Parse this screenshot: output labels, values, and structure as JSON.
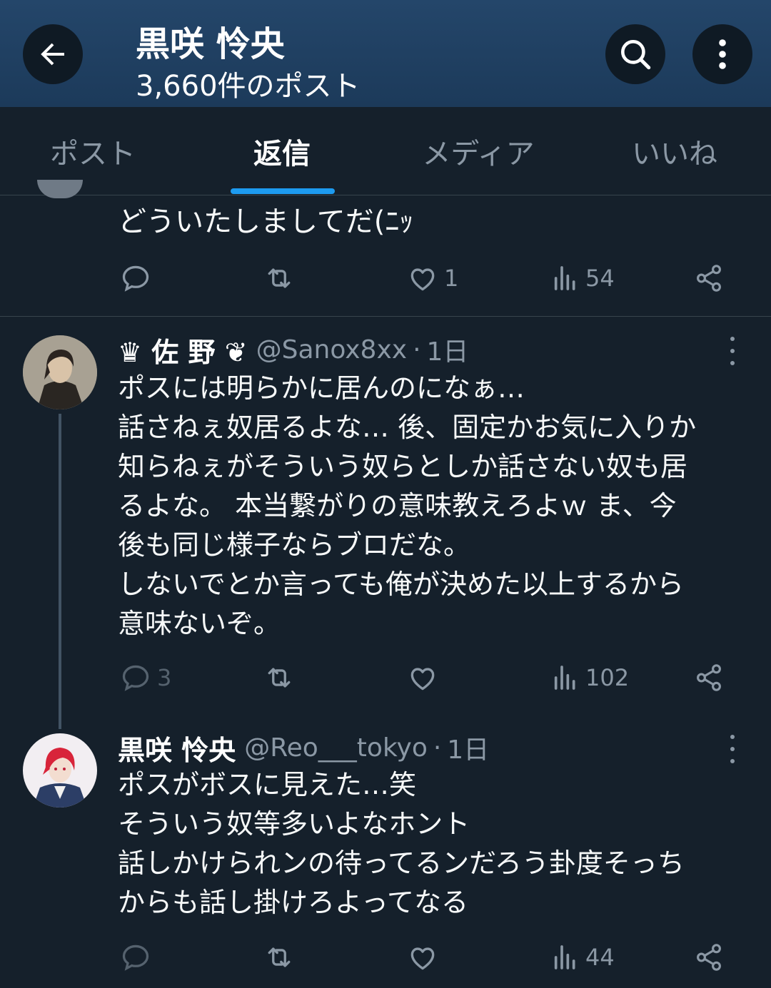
{
  "header": {
    "title": "黒咲 怜央",
    "subtitle": "3,660件のポスト"
  },
  "tabs": [
    {
      "label": "ポスト",
      "active": false
    },
    {
      "label": "返信",
      "active": true
    },
    {
      "label": "メディア",
      "active": false
    },
    {
      "label": "いいね",
      "active": false
    }
  ],
  "posts": [
    {
      "text": "どういたしましてだ(ﾆｯ",
      "replies": "",
      "likes": "1",
      "views": "54"
    },
    {
      "name": "♛ 佐 野 ❦",
      "handle": "@Sanox8xx",
      "sep": "·",
      "date": "1日",
      "lines": [
        "ポスには明らかに居んのになぁ…",
        "話さねぇ奴居るよな… 後、固定かお気に入りか",
        "知らねぇがそういう奴らとしか話さない奴も居",
        "るよな。 本当繋がりの意味教えろよｗ ま、今",
        "後も同じ様子ならブロだな。",
        "しないでとか言っても俺が決めた以上するから",
        "意味ないぞ。"
      ],
      "replies": "3",
      "likes": "",
      "views": "102"
    },
    {
      "name": "黒咲 怜央",
      "handle": "@Reo___tokyo",
      "sep": "·",
      "date": "1日",
      "lines": [
        "ポスがボスに見えた…笑",
        "そういう奴等多いよなホント",
        "話しかけられンの待ってるンだろう卦度そっち",
        "からも話し掛けろよってなる"
      ],
      "replies": "",
      "likes": "",
      "views": "44"
    }
  ],
  "colors": {
    "accent": "#1d9bf0",
    "background": "#15202b",
    "muted": "#8b98a5",
    "divider": "#38444d"
  },
  "icons": [
    "back-arrow-icon",
    "search-icon",
    "more-vertical-icon",
    "reply-icon",
    "repost-icon",
    "like-icon",
    "views-icon",
    "share-icon",
    "more-horizontal-icon"
  ]
}
